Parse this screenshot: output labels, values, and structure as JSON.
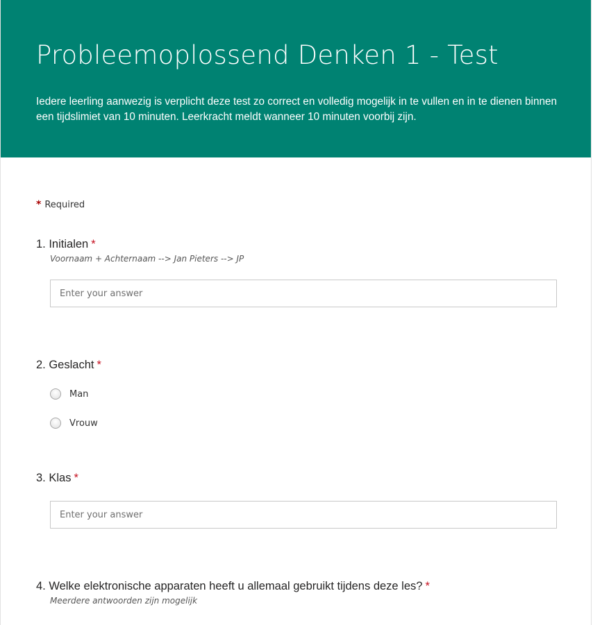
{
  "header": {
    "title": "Probleemoplossend Denken 1 - Test",
    "description": "Iedere leerling aanwezig is verplicht deze test zo correct en volledig mogelijk in te vullen en in te dienen binnen een tijdslimiet van 10 minuten. Leerkracht meldt wanneer 10 minuten voorbij zijn.",
    "background_color": "#008272"
  },
  "required_note": {
    "asterisk": "*",
    "label": "Required"
  },
  "questions": [
    {
      "number_title": "1. Initialen",
      "required_mark": "*",
      "subtitle": "Voornaam + Achternaam --> Jan Pieters --> JP",
      "placeholder": "Enter your answer"
    },
    {
      "number_title": "2. Geslacht",
      "required_mark": "*",
      "options": [
        "Man",
        "Vrouw"
      ]
    },
    {
      "number_title": "3. Klas",
      "required_mark": "*",
      "placeholder": "Enter your answer"
    },
    {
      "number_title": "4. Welke elektronische apparaten heeft u allemaal gebruikt tijdens deze les?",
      "required_mark": "*",
      "subtitle": "Meerdere antwoorden zijn mogelijk"
    }
  ]
}
